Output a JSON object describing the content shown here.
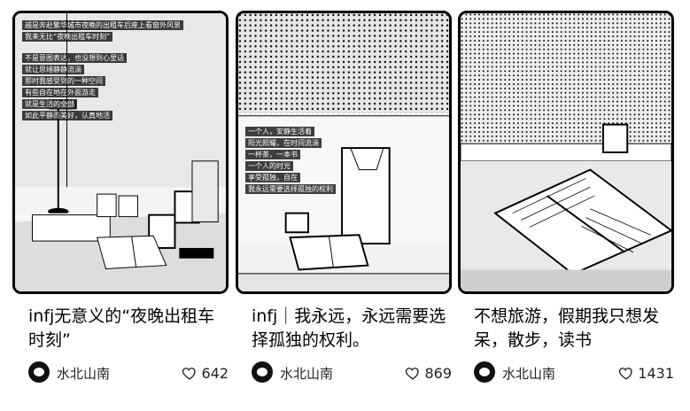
{
  "cards": [
    {
      "title": "infj无意义的“夜晚出租车时刻”",
      "author": "水北山南",
      "likes": "642",
      "overlay": [
        "越是奔赴繁华城市夜晚的出租车后座上看窗外风景",
        "我来无比“夜晚出租车时刻”",
        "",
        "不是意图表达，也没想到心里话",
        "就让思绪静静流淌",
        "那时我感受到的一种空间",
        "有些自在地在外面游走",
        "就是生活的全部",
        "如此平静而美好，认真地活"
      ]
    },
    {
      "title": "infj｜我永远，永远需要选择孤独的权利。",
      "author": "水北山南",
      "likes": "869",
      "overlay": [
        "一个人，安静生活着",
        "阳光照耀，在时间流淌",
        "一杯茶，一本书",
        "一个人的时光",
        "享受孤独，自在",
        "我永远需要选择孤独的权利"
      ]
    },
    {
      "title": "不想旅游，假期我只想发呆，散步，读书",
      "author": "水北山南",
      "likes": "1431",
      "overlay": []
    }
  ],
  "icons": {
    "avatar": "avatar-icon",
    "like": "heart-icon"
  }
}
